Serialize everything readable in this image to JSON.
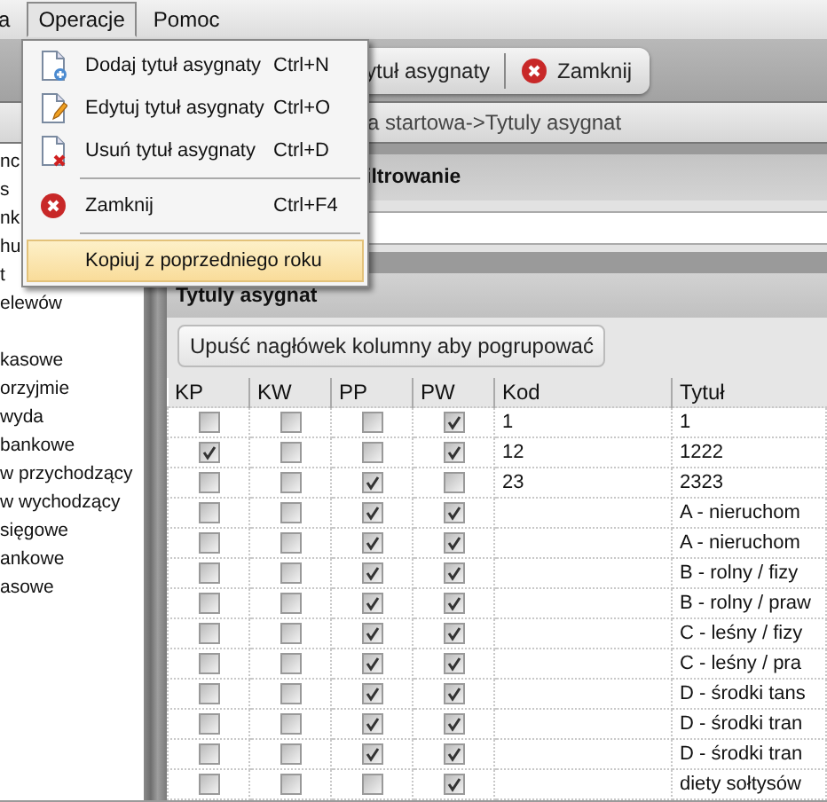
{
  "menubar": [
    {
      "label": "a",
      "selected": false
    },
    {
      "label": "Operacje",
      "selected": true
    },
    {
      "label": "Pomoc",
      "selected": false
    }
  ],
  "menu": [
    {
      "kind": "add",
      "label": "Dodaj tytuł asygnaty",
      "shortcut": "Ctrl+N",
      "selected": false
    },
    {
      "kind": "edit",
      "label": "Edytuj tytuł asygnaty",
      "shortcut": "Ctrl+O",
      "selected": false
    },
    {
      "kind": "delete",
      "label": "Usuń tytuł asygnaty",
      "shortcut": "Ctrl+D",
      "selected": false
    },
    {
      "kind": "separator"
    },
    {
      "kind": "close",
      "label": "Zamknij",
      "shortcut": "Ctrl+F4",
      "selected": false
    },
    {
      "kind": "separator"
    },
    {
      "kind": "plain",
      "label": "Kopiuj z poprzedniego roku",
      "selected": true
    }
  ],
  "toolbar": {
    "edit_button": "ytuł asygnaty",
    "close_button": "Zamknij"
  },
  "breadcrumb": "a startowa->Tytuly asygnat",
  "sidebar": {
    "groups": [
      [
        "nc",
        "s",
        "nk",
        "hu",
        "t",
        "elewów"
      ],
      [
        "kasowe",
        "orzyjmie",
        "wyda",
        "bankowe",
        "w przychodzący",
        "w wychodzący",
        "sięgowe",
        "ankowe",
        "asowe"
      ]
    ]
  },
  "filter": {
    "title": "iltrowanie"
  },
  "grid": {
    "title": "Tytuly asygnat",
    "group_hint": "Upuść nagłówek kolumny aby pogrupować",
    "columns": [
      "KP",
      "KW",
      "PP",
      "PW",
      "Kod",
      "Tytuł"
    ],
    "rows": [
      {
        "kp": false,
        "kw": false,
        "pp": false,
        "pw": true,
        "kod": "1",
        "tytul": "1"
      },
      {
        "kp": true,
        "kw": false,
        "pp": false,
        "pw": true,
        "kod": "12",
        "tytul": "1222"
      },
      {
        "kp": false,
        "kw": false,
        "pp": true,
        "pw": false,
        "kod": "23",
        "tytul": "2323"
      },
      {
        "kp": false,
        "kw": false,
        "pp": true,
        "pw": true,
        "kod": "",
        "tytul": "A - nieruchom"
      },
      {
        "kp": false,
        "kw": false,
        "pp": true,
        "pw": true,
        "kod": "",
        "tytul": "A - nieruchom"
      },
      {
        "kp": false,
        "kw": false,
        "pp": true,
        "pw": true,
        "kod": "",
        "tytul": "B - rolny / fizy"
      },
      {
        "kp": false,
        "kw": false,
        "pp": true,
        "pw": true,
        "kod": "",
        "tytul": "B - rolny / praw"
      },
      {
        "kp": false,
        "kw": false,
        "pp": true,
        "pw": true,
        "kod": "",
        "tytul": "C - leśny / fizy"
      },
      {
        "kp": false,
        "kw": false,
        "pp": true,
        "pw": true,
        "kod": "",
        "tytul": "C - leśny / pra"
      },
      {
        "kp": false,
        "kw": false,
        "pp": true,
        "pw": true,
        "kod": "",
        "tytul": "D - środki tans"
      },
      {
        "kp": false,
        "kw": false,
        "pp": true,
        "pw": true,
        "kod": "",
        "tytul": "D - środki tran"
      },
      {
        "kp": false,
        "kw": false,
        "pp": true,
        "pw": true,
        "kod": "",
        "tytul": "D - środki tran"
      },
      {
        "kp": false,
        "kw": false,
        "pp": false,
        "pw": true,
        "kod": "",
        "tytul": "diety sołtysów"
      }
    ]
  }
}
